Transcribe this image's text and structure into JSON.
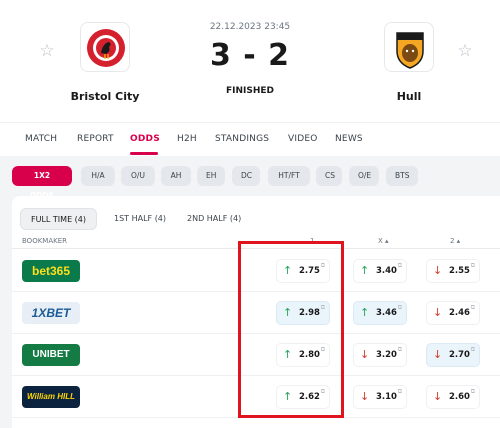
{
  "match": {
    "home_team": "Bristol City",
    "away_team": "Hull",
    "datetime": "22.12.2023 23:45",
    "score": "3 - 2",
    "status": "FINISHED"
  },
  "tabs": [
    "MATCH",
    "REPORT",
    "ODDS",
    "H2H",
    "STANDINGS",
    "VIDEO",
    "NEWS"
  ],
  "active_tab": "ODDS",
  "filters": [
    "1X2 ODDS",
    "H/A",
    "O/U",
    "AH",
    "EH",
    "DC",
    "HT/FT",
    "CS",
    "O/E",
    "BTS"
  ],
  "active_filter": "1X2 ODDS",
  "subtabs": [
    "FULL TIME (4)",
    "1ST HALF (4)",
    "2ND HALF (4)"
  ],
  "table": {
    "col_bookmaker": "BOOKMAKER",
    "col_1": "1",
    "col_x": "X ▴",
    "col_2": "2 ▴"
  },
  "bookmakers": [
    {
      "name": "bet365",
      "odds": [
        {
          "value": "2.75",
          "dir": "up",
          "hl": false
        },
        {
          "value": "3.40",
          "dir": "up",
          "hl": false
        },
        {
          "value": "2.55",
          "dir": "down",
          "hl": false
        }
      ]
    },
    {
      "name": "1XBET",
      "odds": [
        {
          "value": "2.98",
          "dir": "up",
          "hl": true
        },
        {
          "value": "3.46",
          "dir": "up",
          "hl": true
        },
        {
          "value": "2.46",
          "dir": "down",
          "hl": false
        }
      ]
    },
    {
      "name": "UNIBET",
      "odds": [
        {
          "value": "2.80",
          "dir": "up",
          "hl": false
        },
        {
          "value": "3.20",
          "dir": "down",
          "hl": false
        },
        {
          "value": "2.70",
          "dir": "down",
          "hl": true
        }
      ]
    },
    {
      "name": "William HILL",
      "odds": [
        {
          "value": "2.62",
          "dir": "up",
          "hl": false
        },
        {
          "value": "3.10",
          "dir": "down",
          "hl": false
        },
        {
          "value": "2.60",
          "dir": "down",
          "hl": false
        }
      ]
    }
  ],
  "colors": {
    "accent": "#d8004b",
    "up": "#25a35a",
    "down": "#d33a2c",
    "annotation": "#e0141e"
  },
  "icons": {
    "favorite": "star-outline-icon",
    "up": "arrow-up-icon",
    "down": "arrow-down-icon",
    "external": "external-link-icon"
  }
}
